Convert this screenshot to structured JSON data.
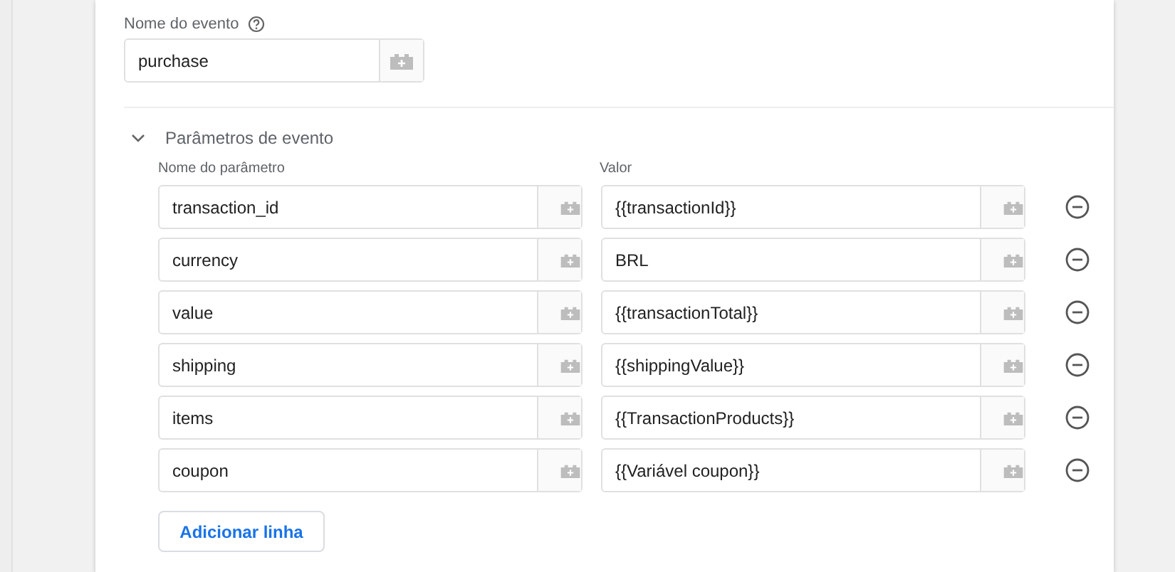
{
  "event_name": {
    "label": "Nome do evento",
    "value": "purchase"
  },
  "section": {
    "title": "Parâmetros de evento",
    "expanded": true,
    "columns": [
      "Nome do parâmetro",
      "Valor"
    ],
    "rows": [
      {
        "name": "transaction_id",
        "value": "{{transactionId}}"
      },
      {
        "name": "currency",
        "value": "BRL"
      },
      {
        "name": "value",
        "value": "{{transactionTotal}}"
      },
      {
        "name": "shipping",
        "value": "{{shippingValue}}"
      },
      {
        "name": "items",
        "value": "{{TransactionProducts}}"
      },
      {
        "name": "coupon",
        "value": "{{Variável coupon}}"
      }
    ],
    "add_button": "Adicionar linha"
  }
}
